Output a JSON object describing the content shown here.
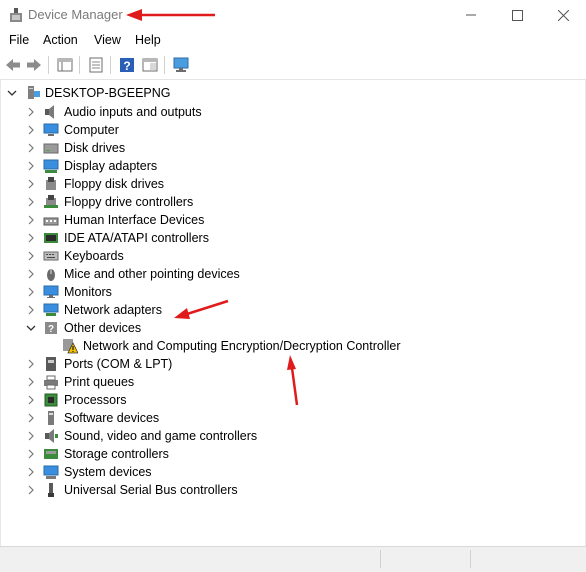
{
  "window": {
    "title": "Device Manager"
  },
  "menu": {
    "file": "File",
    "action": "Action",
    "view": "View",
    "help": "Help"
  },
  "tree": {
    "root": "DESKTOP-BGEEPNG",
    "categories": [
      {
        "label": "Audio inputs and outputs",
        "icon": "speaker-icon"
      },
      {
        "label": "Computer",
        "icon": "computer-icon"
      },
      {
        "label": "Disk drives",
        "icon": "disk-drive-icon"
      },
      {
        "label": "Display adapters",
        "icon": "display-adapter-icon"
      },
      {
        "label": "Floppy disk drives",
        "icon": "floppy-disk-icon"
      },
      {
        "label": "Floppy drive controllers",
        "icon": "floppy-controller-icon"
      },
      {
        "label": "Human Interface Devices",
        "icon": "hid-icon"
      },
      {
        "label": "IDE ATA/ATAPI controllers",
        "icon": "ide-controller-icon"
      },
      {
        "label": "Keyboards",
        "icon": "keyboard-icon"
      },
      {
        "label": "Mice and other pointing devices",
        "icon": "mouse-icon"
      },
      {
        "label": "Monitors",
        "icon": "monitor-icon"
      },
      {
        "label": "Network adapters",
        "icon": "network-adapter-icon"
      },
      {
        "label": "Other devices",
        "icon": "unknown-device-icon",
        "expanded": true
      },
      {
        "label": "Network and Computing Encryption/Decryption Controller",
        "icon": "warning-device-icon",
        "child": true
      },
      {
        "label": "Ports (COM & LPT)",
        "icon": "port-icon"
      },
      {
        "label": "Print queues",
        "icon": "printer-icon"
      },
      {
        "label": "Processors",
        "icon": "processor-icon"
      },
      {
        "label": "Software devices",
        "icon": "software-device-icon"
      },
      {
        "label": "Sound, video and game controllers",
        "icon": "sound-controller-icon"
      },
      {
        "label": "Storage controllers",
        "icon": "storage-controller-icon"
      },
      {
        "label": "System devices",
        "icon": "system-device-icon"
      },
      {
        "label": "Universal Serial Bus controllers",
        "icon": "usb-icon"
      }
    ]
  },
  "colors": {
    "annotation_arrow": "#e01b1b",
    "title_text": "#7a7a7a",
    "accent": "#1e73c8"
  }
}
